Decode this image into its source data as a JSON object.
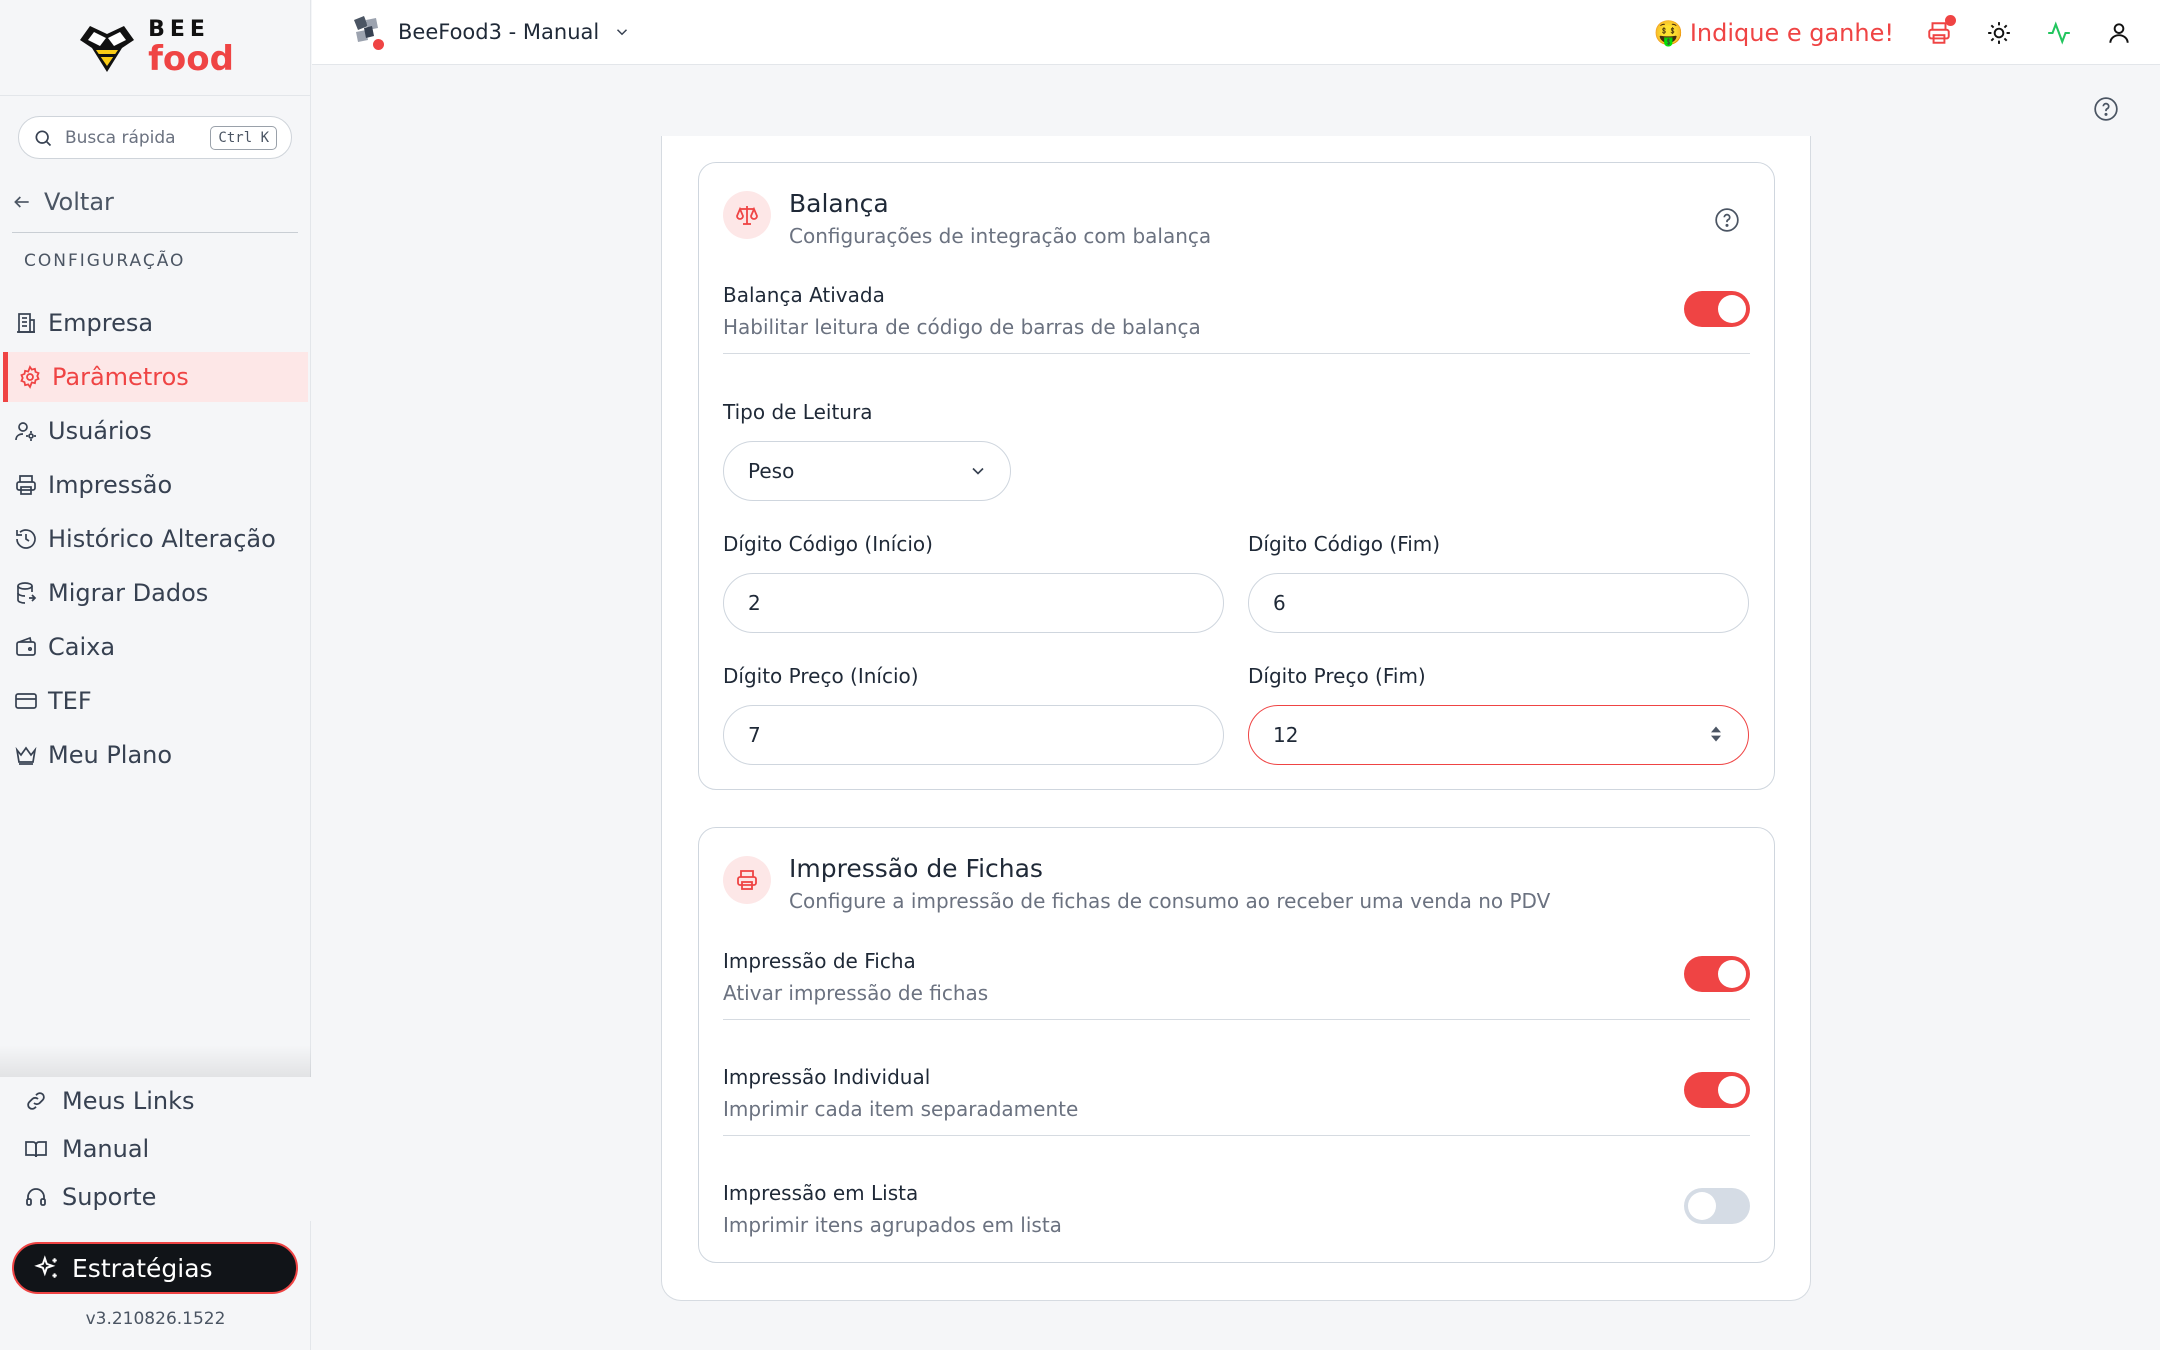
{
  "brand": {
    "word1": "BEE",
    "word2": "food"
  },
  "search": {
    "placeholder": "Busca rápida",
    "shortcut": "Ctrl K"
  },
  "sidebar": {
    "back_label": "Voltar",
    "section_title": "CONFIGURAÇÃO",
    "items": [
      {
        "label": "Empresa",
        "icon": "building-icon"
      },
      {
        "label": "Parâmetros",
        "icon": "gear-icon",
        "active": true
      },
      {
        "label": "Usuários",
        "icon": "users-icon"
      },
      {
        "label": "Impressão",
        "icon": "printer-icon"
      },
      {
        "label": "Histórico Alteração",
        "icon": "history-icon"
      },
      {
        "label": "Migrar Dados",
        "icon": "database-icon"
      },
      {
        "label": "Caixa",
        "icon": "wallet-icon"
      },
      {
        "label": "TEF",
        "icon": "card-icon"
      },
      {
        "label": "Meu Plano",
        "icon": "crown-icon"
      }
    ],
    "bottom": [
      {
        "label": "Meus Links",
        "icon": "link-icon"
      },
      {
        "label": "Manual",
        "icon": "book-icon"
      },
      {
        "label": "Suporte",
        "icon": "headset-icon"
      }
    ],
    "strategies_label": "Estratégias",
    "version": "v3.210826.1522"
  },
  "topbar": {
    "store_name": "BeeFood3 - Manual",
    "referral_emoji": "🤑",
    "referral_label": "Indique e ganhe!",
    "icons": [
      "printer-icon",
      "sun-icon",
      "activity-icon",
      "user-icon"
    ]
  },
  "colors": {
    "accent": "#ef4444",
    "accent_soft": "#fde7e7",
    "activity": "#22c55e"
  },
  "balanca": {
    "title": "Balança",
    "subtitle": "Configurações de integração com balança",
    "enabled_title": "Balança Ativada",
    "enabled_sub": "Habilitar leitura de código de barras de balança",
    "enabled": true,
    "tipo_label": "Tipo de Leitura",
    "tipo_value": "Peso",
    "codigo_inicio_label": "Dígito Código (Início)",
    "codigo_inicio_value": "2",
    "codigo_fim_label": "Dígito Código (Fim)",
    "codigo_fim_value": "6",
    "preco_inicio_label": "Dígito Preço (Início)",
    "preco_inicio_value": "7",
    "preco_fim_label": "Dígito Preço (Fim)",
    "preco_fim_value": "12"
  },
  "fichas": {
    "title": "Impressão de Fichas",
    "subtitle": "Configure a impressão de fichas de consumo ao receber uma venda no PDV",
    "rows": [
      {
        "title": "Impressão de Ficha",
        "sub": "Ativar impressão de fichas",
        "enabled": true
      },
      {
        "title": "Impressão Individual",
        "sub": "Imprimir cada item separadamente",
        "enabled": true
      },
      {
        "title": "Impressão em Lista",
        "sub": "Imprimir itens agrupados em lista",
        "enabled": false
      }
    ]
  }
}
